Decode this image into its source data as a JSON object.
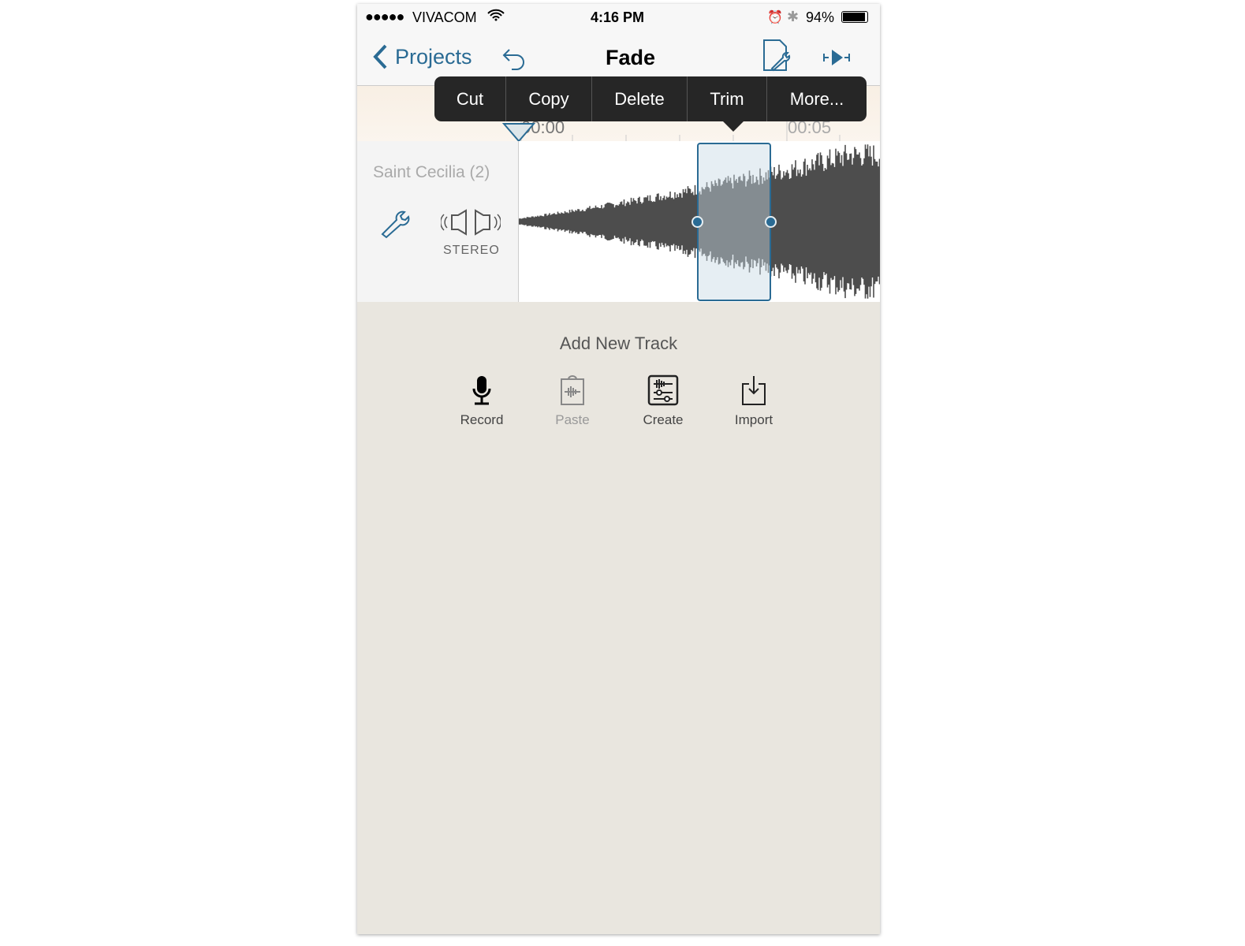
{
  "status": {
    "signal": "●●●●●",
    "carrier": "VIVACOM",
    "time": "4:16 PM",
    "battery": "94%"
  },
  "nav": {
    "back_label": "Projects",
    "title": "Fade"
  },
  "context_menu": [
    "Cut",
    "Copy",
    "Delete",
    "Trim",
    "More..."
  ],
  "ruler": {
    "labels": [
      "00:00",
      "00:05"
    ]
  },
  "track": {
    "name": "Saint Cecilia (2)",
    "channel_mode": "STEREO"
  },
  "add_track": {
    "heading": "Add New Track",
    "tools": [
      {
        "label": "Record",
        "icon": "microphone-icon"
      },
      {
        "label": "Paste",
        "icon": "clipboard-icon",
        "disabled": true
      },
      {
        "label": "Create",
        "icon": "create-icon"
      },
      {
        "label": "Import",
        "icon": "import-icon"
      }
    ]
  },
  "colors": {
    "accent": "#2a6b94",
    "waveform": "#4d4d4d",
    "selection": "#e6eef2"
  }
}
